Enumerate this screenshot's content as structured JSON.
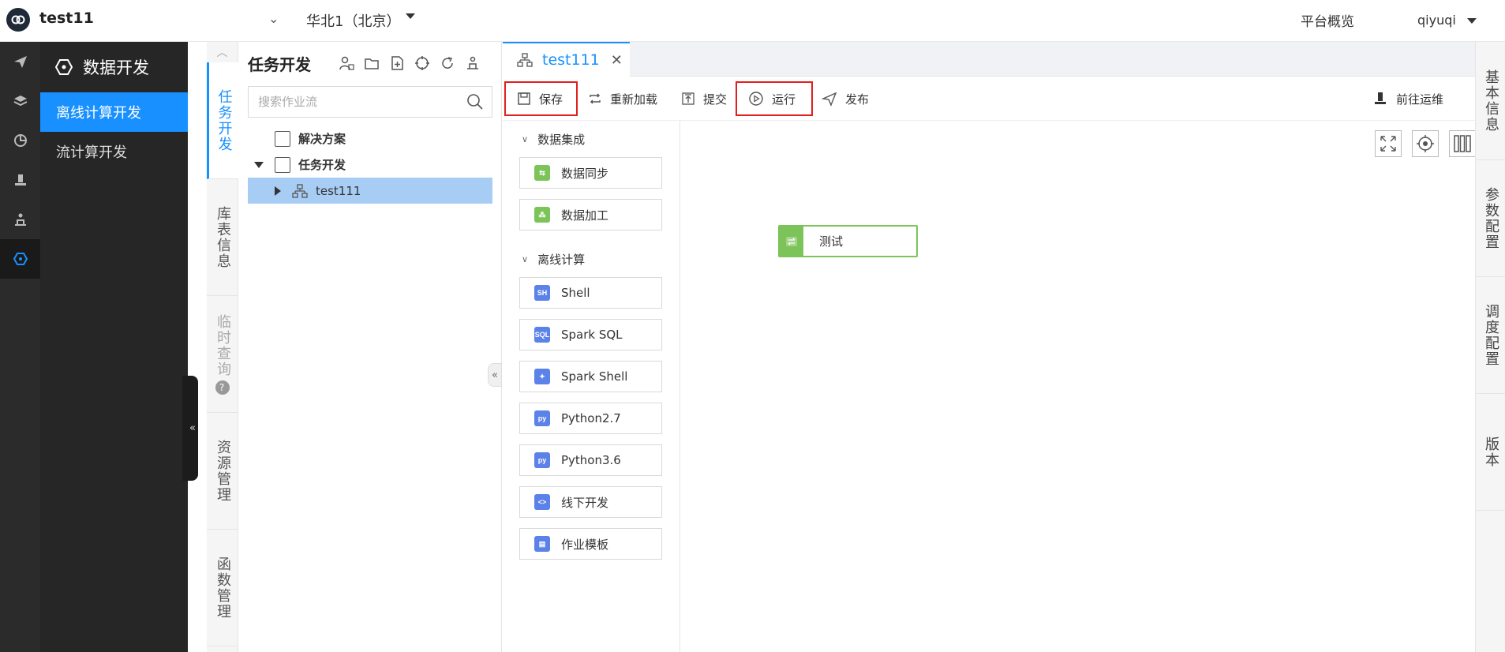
{
  "header": {
    "app_title": "test11",
    "region": "华北1（北京）",
    "overview_label": "平台概览",
    "username": "qiyuqi"
  },
  "sidebar": {
    "title": "数据开发",
    "items": [
      {
        "label": "离线计算开发",
        "active": true
      },
      {
        "label": "流计算开发",
        "active": false
      }
    ]
  },
  "vtabs": [
    {
      "label": "任务开发",
      "active": true
    },
    {
      "label": "库表信息",
      "active": false
    },
    {
      "label": "临时查询",
      "disabled": true,
      "help": "?"
    },
    {
      "label": "资源管理",
      "active": false
    },
    {
      "label": "函数管理",
      "active": false
    }
  ],
  "tree": {
    "title": "任务开发",
    "search_placeholder": "搜索作业流",
    "nodes": [
      {
        "label": "解决方案"
      },
      {
        "label": "任务开发"
      },
      {
        "label": "test111",
        "selected": true
      }
    ]
  },
  "editor": {
    "tab_label": "test111",
    "toolbar": {
      "save": "保存",
      "reload": "重新加载",
      "submit": "提交",
      "run": "运行",
      "publish": "发布",
      "goto_ops": "前往运维"
    },
    "palette": {
      "group1": "数据集成",
      "group1_items": [
        "数据同步",
        "数据加工"
      ],
      "group2": "离线计算",
      "group2_items": [
        {
          "label": "Shell",
          "badge": "SH"
        },
        {
          "label": "Spark SQL",
          "badge": "SQL"
        },
        {
          "label": "Spark Shell",
          "badge": "✦"
        },
        {
          "label": "Python2.7",
          "badge": "py"
        },
        {
          "label": "Python3.6",
          "badge": "py"
        },
        {
          "label": "线下开发",
          "badge": "<>"
        },
        {
          "label": "作业模板",
          "badge": "▤"
        }
      ]
    },
    "canvas_node": "测试"
  },
  "rightbar": [
    "基本信息",
    "参数配置",
    "调度配置",
    "版本"
  ],
  "colors": {
    "accent": "#1890ff",
    "highlight_box": "#e0201c",
    "node_green": "#7cc35a"
  }
}
